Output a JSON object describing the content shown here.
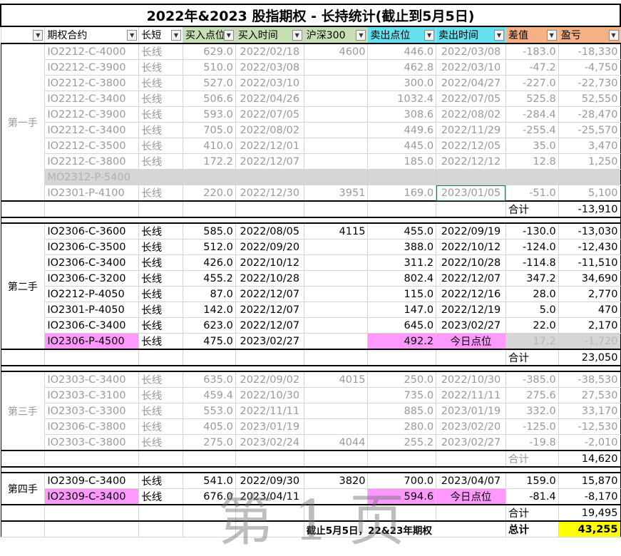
{
  "title": "2022年&2023 股指期权 - 长持统计(截止到5月5日)",
  "headers": [
    "期权合约",
    "长短",
    "买入点位",
    "买入时间",
    "沪深300",
    "卖出点位",
    "卖出时间",
    "差值",
    "盈亏"
  ],
  "sections": [
    {
      "label": "第一手",
      "rows": [
        {
          "c": "IO2212-C-4000",
          "t": "长线",
          "bp": "629.0",
          "bd": "2022/02/18",
          "hs": "4600",
          "sp": "446.0",
          "sd": "2022/03/08",
          "diff": "-183.0",
          "pl": "-18,330"
        },
        {
          "c": "IO2212-C-3900",
          "t": "长线",
          "bp": "510.0",
          "bd": "2022/03/08",
          "hs": "",
          "sp": "462.8",
          "sd": "2022/03/10",
          "diff": "-47.2",
          "pl": "-4,750"
        },
        {
          "c": "IO2212-C-3800",
          "t": "长线",
          "bp": "527.0",
          "bd": "2022/03/10",
          "hs": "",
          "sp": "300.0",
          "sd": "2022/04/27",
          "diff": "-227.0",
          "pl": "-22,730"
        },
        {
          "c": "IO2212-C-3400",
          "t": "长线",
          "bp": "506.6",
          "bd": "2022/04/26",
          "hs": "",
          "sp": "1032.4",
          "sd": "2022/07/05",
          "diff": "525.8",
          "pl": "52,550"
        },
        {
          "c": "IO2212-C-3900",
          "t": "长线",
          "bp": "593.0",
          "bd": "2022/07/05",
          "hs": "",
          "sp": "308.6",
          "sd": "2022/08/02",
          "diff": "-284.4",
          "pl": "-28,470"
        },
        {
          "c": "IO2212-C-3400",
          "t": "长线",
          "bp": "705.0",
          "bd": "2022/08/02",
          "hs": "",
          "sp": "449.6",
          "sd": "2022/11/29",
          "diff": "-255.4",
          "pl": "-25,570"
        },
        {
          "c": "IO2212-C-3500",
          "t": "长线",
          "bp": "410.0",
          "bd": "2022/12/01",
          "hs": "",
          "sp": "445.0",
          "sd": "2022/12/05",
          "diff": "35.0",
          "pl": "3,470"
        },
        {
          "c": "IO2212-C-3800",
          "t": "长线",
          "bp": "172.2",
          "bd": "2022/12/07",
          "hs": "",
          "sp": "185.0",
          "sd": "2022/12/12",
          "diff": "12.8",
          "pl": "1,250"
        },
        {
          "c": "MO2312-P-5400",
          "t": "",
          "bp": "",
          "bd": "",
          "hs": "",
          "sp": "",
          "sd": "",
          "diff": "",
          "pl": ""
        },
        {
          "c": "IO2301-P-4100",
          "t": "长线",
          "bp": "220.0",
          "bd": "2022/12/30",
          "hs": "3951",
          "sp": "169.0",
          "sd": "2023/01/05",
          "diff": "-51.0",
          "pl": "5,100"
        }
      ],
      "total_label": "合计",
      "total": "-13,910"
    },
    {
      "label": "第二手",
      "rows": [
        {
          "c": "IO2306-C-3600",
          "t": "长线",
          "bp": "585.0",
          "bd": "2022/08/05",
          "hs": "4115",
          "sp": "455.0",
          "sd": "2022/09/19",
          "diff": "-130.0",
          "pl": "-13,030"
        },
        {
          "c": "IO2306-C-3500",
          "t": "长线",
          "bp": "512.0",
          "bd": "2022/09/20",
          "hs": "",
          "sp": "388.0",
          "sd": "2022/10/12",
          "diff": "-124.0",
          "pl": "-12,430"
        },
        {
          "c": "IO2306-C-3400",
          "t": "长线",
          "bp": "426.0",
          "bd": "2022/10/12",
          "hs": "",
          "sp": "311.2",
          "sd": "2022/10/28",
          "diff": "-114.8",
          "pl": "-11,510"
        },
        {
          "c": "IO2306-C-3200",
          "t": "长线",
          "bp": "455.2",
          "bd": "2022/10/28",
          "hs": "",
          "sp": "802.4",
          "sd": "2022/12/07",
          "diff": "347.2",
          "pl": "34,690"
        },
        {
          "c": "IO2212-P-4050",
          "t": "长线",
          "bp": "87.0",
          "bd": "2022/12/07",
          "hs": "",
          "sp": "115.0",
          "sd": "2022/12/16",
          "diff": "28.0",
          "pl": "2,770"
        },
        {
          "c": "IO2301-P-4050",
          "t": "长线",
          "bp": "142.0",
          "bd": "2022/12/07",
          "hs": "",
          "sp": "147.0",
          "sd": "2022/12/19",
          "diff": "5.0",
          "pl": "470"
        },
        {
          "c": "IO2306-C-3400",
          "t": "长线",
          "bp": "623.0",
          "bd": "2022/12/07",
          "hs": "",
          "sp": "645.0",
          "sd": "2023/02/27",
          "diff": "22.0",
          "pl": "2,170"
        },
        {
          "c": "IO2306-P-4500",
          "t": "长线",
          "bp": "475.0",
          "bd": "2023/02/27",
          "hs": "",
          "sp": "492.2",
          "sd": "今日点位",
          "diff": "17.2",
          "pl": "-1,720"
        }
      ],
      "total_label": "合计",
      "total": "23,050"
    },
    {
      "label": "第三手",
      "rows": [
        {
          "c": "IO2303-C-3400",
          "t": "长线",
          "bp": "635.0",
          "bd": "2022/09/02",
          "hs": "4015",
          "sp": "250.0",
          "sd": "2022/10/30",
          "diff": "-385.0",
          "pl": "-38,530"
        },
        {
          "c": "IO2303-C-3100",
          "t": "长线",
          "bp": "459.4",
          "bd": "2022/10/30",
          "hs": "",
          "sp": "735.0",
          "sd": "2022/11/11",
          "diff": "275.6",
          "pl": "27,530"
        },
        {
          "c": "IO2303-C-3300",
          "t": "长线",
          "bp": "553.0",
          "bd": "2022/11/11",
          "hs": "",
          "sp": "885.0",
          "sd": "2023/01/19",
          "diff": "332.0",
          "pl": "33,170"
        },
        {
          "c": "IO2306-C-3800",
          "t": "长线",
          "bp": "405.0",
          "bd": "2023/01/19",
          "hs": "",
          "sp": "280.0",
          "sd": "2023/02/20",
          "diff": "-125.0",
          "pl": "-12,530"
        },
        {
          "c": "IO2303-C-3800",
          "t": "长线",
          "bp": "275.0",
          "bd": "2023/02/24",
          "hs": "4044",
          "sp": "255.2",
          "sd": "2023/02/27",
          "diff": "-19.8",
          "pl": "-2,010"
        }
      ],
      "total_label": "合计",
      "total": "14,620"
    },
    {
      "label": "第四手",
      "rows": [
        {
          "c": "IO2309-C-3400",
          "t": "长线",
          "bp": "541.0",
          "bd": "2022/09/30",
          "hs": "3820",
          "sp": "700.0",
          "sd": "2023/04/07",
          "diff": "159.0",
          "pl": "15,870"
        },
        {
          "c": "IO2309-C-3400",
          "t": "长线",
          "bp": "676.0",
          "bd": "2023/04/11",
          "hs": "",
          "sp": "594.6",
          "sd": "今日点位",
          "diff": "-81.4",
          "pl": "-8,170"
        }
      ],
      "total_label": "合计",
      "total": "19,495"
    }
  ],
  "footer": {
    "note": "截止5月5日，22&23年期权",
    "label": "总计",
    "value": "43,255"
  },
  "watermark": "第1页",
  "colors": {
    "pink": "#ff99ff",
    "green_header": "#c6e0b4",
    "cyan_header": "#66e0ee",
    "orange_header": "#f4b183",
    "yellow": "#ffff00"
  }
}
